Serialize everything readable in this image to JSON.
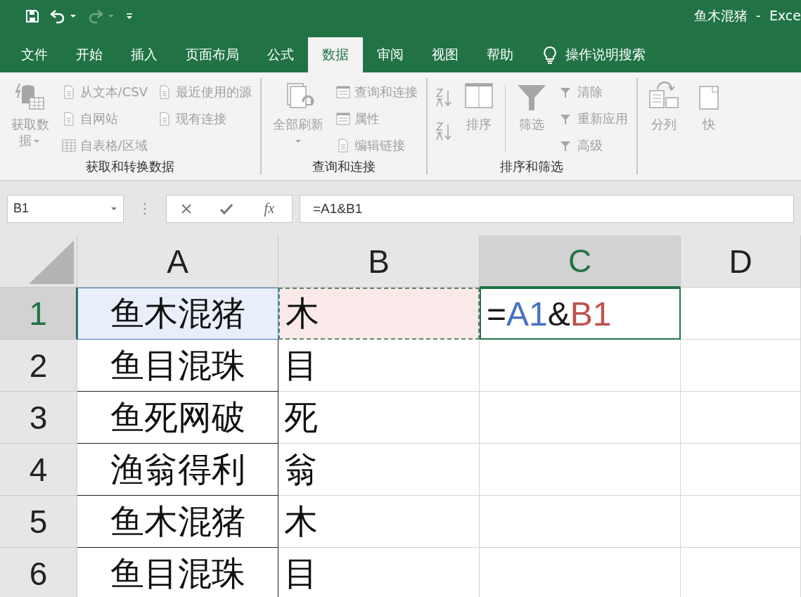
{
  "window": {
    "title": "鱼木混猪  -  Exce"
  },
  "quick_access": [
    {
      "kind": "save",
      "disabled": false
    },
    {
      "kind": "undo",
      "disabled": false
    },
    {
      "kind": "redo",
      "disabled": true
    },
    {
      "kind": "customize",
      "disabled": false
    }
  ],
  "tabs": [
    {
      "label": "文件",
      "selected": false
    },
    {
      "label": "开始",
      "selected": false
    },
    {
      "label": "插入",
      "selected": false
    },
    {
      "label": "页面布局",
      "selected": false
    },
    {
      "label": "公式",
      "selected": false
    },
    {
      "label": "数据",
      "selected": true
    },
    {
      "label": "审阅",
      "selected": false
    },
    {
      "label": "视图",
      "selected": false
    },
    {
      "label": "帮助",
      "selected": false
    }
  ],
  "tell_me": "操作说明搜索",
  "ribbon_groups": [
    {
      "label": "获取和转换数据",
      "sections": [
        {
          "kind": "large",
          "label": "获取数据",
          "caret": true,
          "disabled": true
        },
        {
          "kind": "column",
          "items": [
            {
              "label": "从文本/CSV",
              "disabled": true
            },
            {
              "label": "自网站",
              "disabled": true
            },
            {
              "label": "自表格/区域",
              "disabled": true
            }
          ]
        },
        {
          "kind": "column",
          "items": [
            {
              "label": "最近使用的源",
              "disabled": true
            },
            {
              "label": "现有连接",
              "disabled": true
            }
          ]
        }
      ]
    },
    {
      "label": "查询和连接",
      "sections": [
        {
          "kind": "large",
          "label": "全部刷新",
          "caret": true,
          "disabled": true
        },
        {
          "kind": "column",
          "items": [
            {
              "label": "查询和连接",
              "disabled": true
            },
            {
              "label": "属性",
              "disabled": true
            },
            {
              "label": "编辑链接",
              "disabled": true
            }
          ]
        }
      ]
    },
    {
      "label": "排序和筛选",
      "sections": [
        {
          "kind": "icons",
          "items": [
            {
              "disabled": true
            },
            {
              "disabled": true
            }
          ]
        },
        {
          "kind": "large",
          "label": "排序",
          "caret": false,
          "disabled": true
        },
        {
          "kind": "divider"
        },
        {
          "kind": "large",
          "label": "筛选",
          "caret": false,
          "disabled": true
        },
        {
          "kind": "column",
          "items": [
            {
              "label": "清除",
              "disabled": true
            },
            {
              "label": "重新应用",
              "disabled": true
            },
            {
              "label": "高级",
              "disabled": true
            }
          ]
        }
      ]
    },
    {
      "sections": [
        {
          "kind": "large",
          "label": "分列",
          "caret": false,
          "disabled": true
        },
        {
          "kind": "large",
          "label": "快",
          "caret": false,
          "disabled": true
        }
      ]
    }
  ],
  "formula_bar": {
    "name_box": "B1",
    "function_label": "fx",
    "formula": "=A1&B1"
  },
  "columns": [
    {
      "label": "A",
      "selected": false
    },
    {
      "label": "B",
      "selected": false
    },
    {
      "label": "C",
      "selected": true
    },
    {
      "label": "D",
      "selected": false
    }
  ],
  "rows": [
    {
      "label": "1",
      "selected": true,
      "cells": [
        {
          "text": "鱼木混猪",
          "color": "#e8eff9"
        },
        {
          "text": "木",
          "color": "#f9e9e9"
        },
        {
          "active": true,
          "parts": [
            {
              "text": "=",
              "color": "#1a1a1a"
            },
            {
              "text": "A1",
              "color": "#4472c4"
            },
            {
              "text": "&",
              "color": "#1a1a1a"
            },
            {
              "text": "B1",
              "color": "#c0504d"
            }
          ]
        }
      ]
    },
    {
      "label": "2",
      "selected": false,
      "cells": [
        {
          "text": "鱼目混珠"
        },
        {
          "text": "目"
        }
      ]
    },
    {
      "label": "3",
      "selected": false,
      "cells": [
        {
          "text": "鱼死网破"
        },
        {
          "text": "死"
        }
      ]
    },
    {
      "label": "4",
      "selected": false,
      "cells": [
        {
          "text": "渔翁得利"
        },
        {
          "text": "翁"
        }
      ]
    },
    {
      "label": "5",
      "selected": false,
      "cells": [
        {
          "text": "鱼木混猪"
        },
        {
          "text": "木"
        }
      ]
    },
    {
      "label": "6",
      "selected": false,
      "cells": [
        {
          "text": "鱼目混珠"
        },
        {
          "text": "目"
        }
      ]
    }
  ]
}
